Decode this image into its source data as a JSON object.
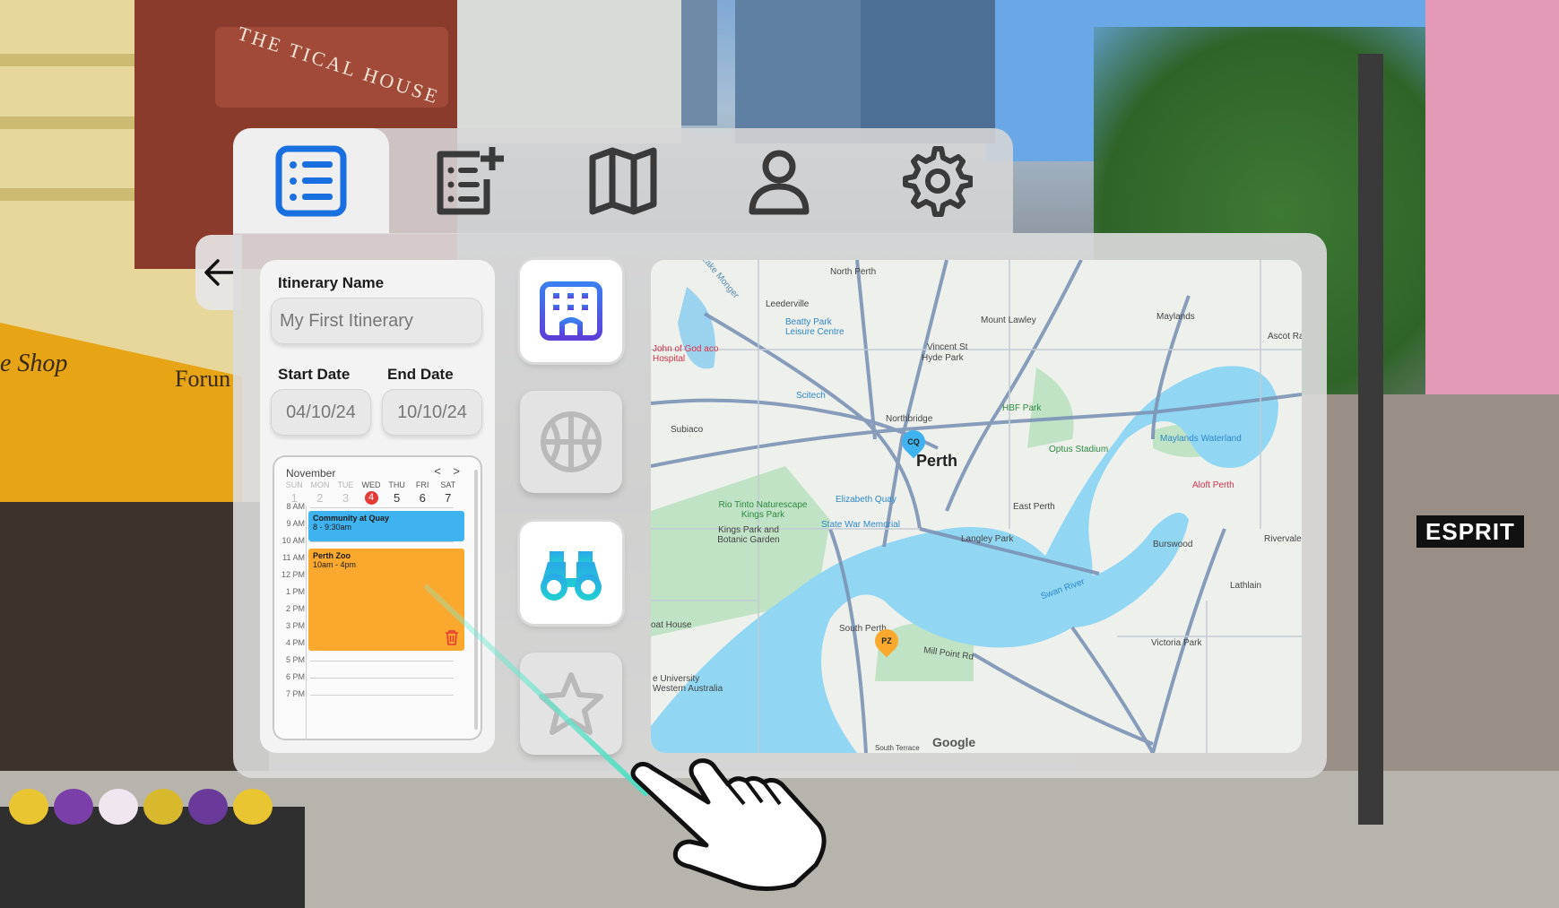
{
  "tabs": [
    {
      "id": "itinerary",
      "icon": "list-icon",
      "active": true
    },
    {
      "id": "new",
      "icon": "add-list-icon",
      "active": false
    },
    {
      "id": "map",
      "icon": "map-icon",
      "active": false
    },
    {
      "id": "profile",
      "icon": "user-icon",
      "active": false
    },
    {
      "id": "settings",
      "icon": "gear-icon",
      "active": false
    }
  ],
  "form": {
    "name_label": "Itinerary Name",
    "name_placeholder": "My First Itinerary",
    "start_label": "Start Date",
    "end_label": "End Date",
    "start_value": "04/10/24",
    "end_value": "10/10/24"
  },
  "calendar": {
    "month": "November",
    "nav": "< >",
    "days": [
      {
        "dow": "SUN",
        "num": "1"
      },
      {
        "dow": "MON",
        "num": "2"
      },
      {
        "dow": "TUE",
        "num": "3"
      },
      {
        "dow": "WED",
        "num": "4"
      },
      {
        "dow": "THU",
        "num": "5"
      },
      {
        "dow": "FRI",
        "num": "6"
      },
      {
        "dow": "SAT",
        "num": "7"
      }
    ],
    "hours": [
      "8 AM",
      "9 AM",
      "10 AM",
      "11 AM",
      "12 PM",
      "1 PM",
      "2 PM",
      "3 PM",
      "4 PM",
      "5 PM",
      "6 PM",
      "7 PM"
    ],
    "events": [
      {
        "title": "Community at Quay",
        "time": "8 - 9:30am",
        "color": "#3fb3f0"
      },
      {
        "title": "Perth Zoo",
        "time": "10am - 4pm",
        "color": "#fba92e"
      }
    ]
  },
  "categories": [
    {
      "icon": "hotel-icon",
      "selected": true
    },
    {
      "icon": "basketball-icon",
      "selected": false
    },
    {
      "icon": "binoculars-icon",
      "selected": true
    },
    {
      "icon": "star-icon",
      "selected": false
    }
  ],
  "map": {
    "city_label": "Perth",
    "attribution": "Google",
    "labels": {
      "north_perth": "North Perth",
      "leederville": "Leederville",
      "mount_lawley": "Mount Lawley",
      "maylands": "Maylands",
      "lake_monger": "Lake Monger",
      "beatty_park": "Beatty Park Leisure Centre",
      "vincent_st": "Vincent St",
      "hyde_park": "Hyde Park",
      "ascot": "Ascot Racec",
      "john_of_god": "John of God aco Hospital",
      "scitech": "Scitech",
      "hbf_park": "HBF Park",
      "northbridge": "Northbridge",
      "subiaco": "Subiaco",
      "optus": "Optus Stadium",
      "maylands_waterland": "Maylands Waterland",
      "rio_tinto": "Rio Tinto Naturescape Kings Park",
      "elizabeth_quay": "Elizabeth Quay",
      "east_perth": "East Perth",
      "aloft": "Aloft Perth",
      "kings_park": "Kings Park and Botanic Garden",
      "war_memorial": "State War Memorial",
      "langley_park": "Langley Park",
      "burswood": "Burswood",
      "rivervale": "Rivervale",
      "lathlain": "Lathlain",
      "swan_river": "Swan River",
      "boat_house": "oat House",
      "south_perth": "South Perth",
      "mill_point": "Mill Point Rd",
      "victoria_park": "Victoria Park",
      "uwa": "e University Western Australia",
      "south_terrace": "South Terrace",
      "cq_pin": "CQ",
      "pz_pin": "PZ"
    }
  },
  "background": {
    "sign_text": "THE TICAL HOUSE",
    "shop_text": "e Shop",
    "forum_text": "Forun",
    "esprit_text": "ESPRIT"
  }
}
